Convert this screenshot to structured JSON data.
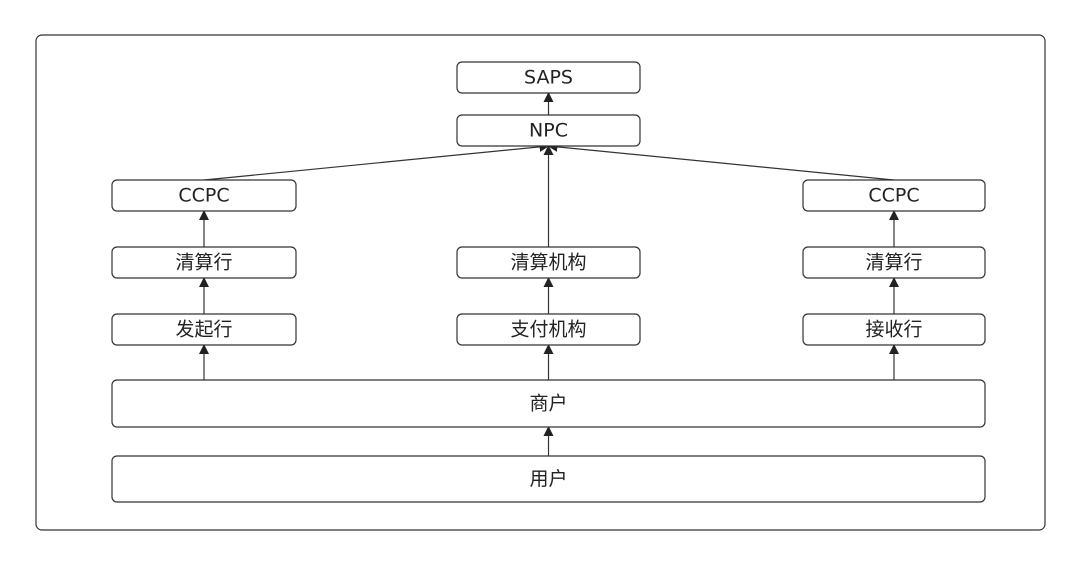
{
  "nodes": {
    "saps": "SAPS",
    "npc": "NPC",
    "ccpc_left": "CCPC",
    "ccpc_right": "CCPC",
    "clearing_bank_left": "清算行",
    "clearing_org": "清算机构",
    "clearing_bank_right": "清算行",
    "originating_bank": "发起行",
    "payment_org": "支付机构",
    "receiving_bank": "接收行",
    "merchant": "商户",
    "user": "用户"
  },
  "edges": [
    [
      "user",
      "merchant"
    ],
    [
      "merchant",
      "originating_bank"
    ],
    [
      "merchant",
      "payment_org"
    ],
    [
      "merchant",
      "receiving_bank"
    ],
    [
      "originating_bank",
      "clearing_bank_left"
    ],
    [
      "clearing_bank_left",
      "ccpc_left"
    ],
    [
      "payment_org",
      "clearing_org"
    ],
    [
      "receiving_bank",
      "clearing_bank_right"
    ],
    [
      "clearing_bank_right",
      "ccpc_right"
    ],
    [
      "ccpc_left",
      "npc"
    ],
    [
      "clearing_org",
      "npc"
    ],
    [
      "ccpc_right",
      "npc"
    ],
    [
      "npc",
      "saps"
    ]
  ]
}
